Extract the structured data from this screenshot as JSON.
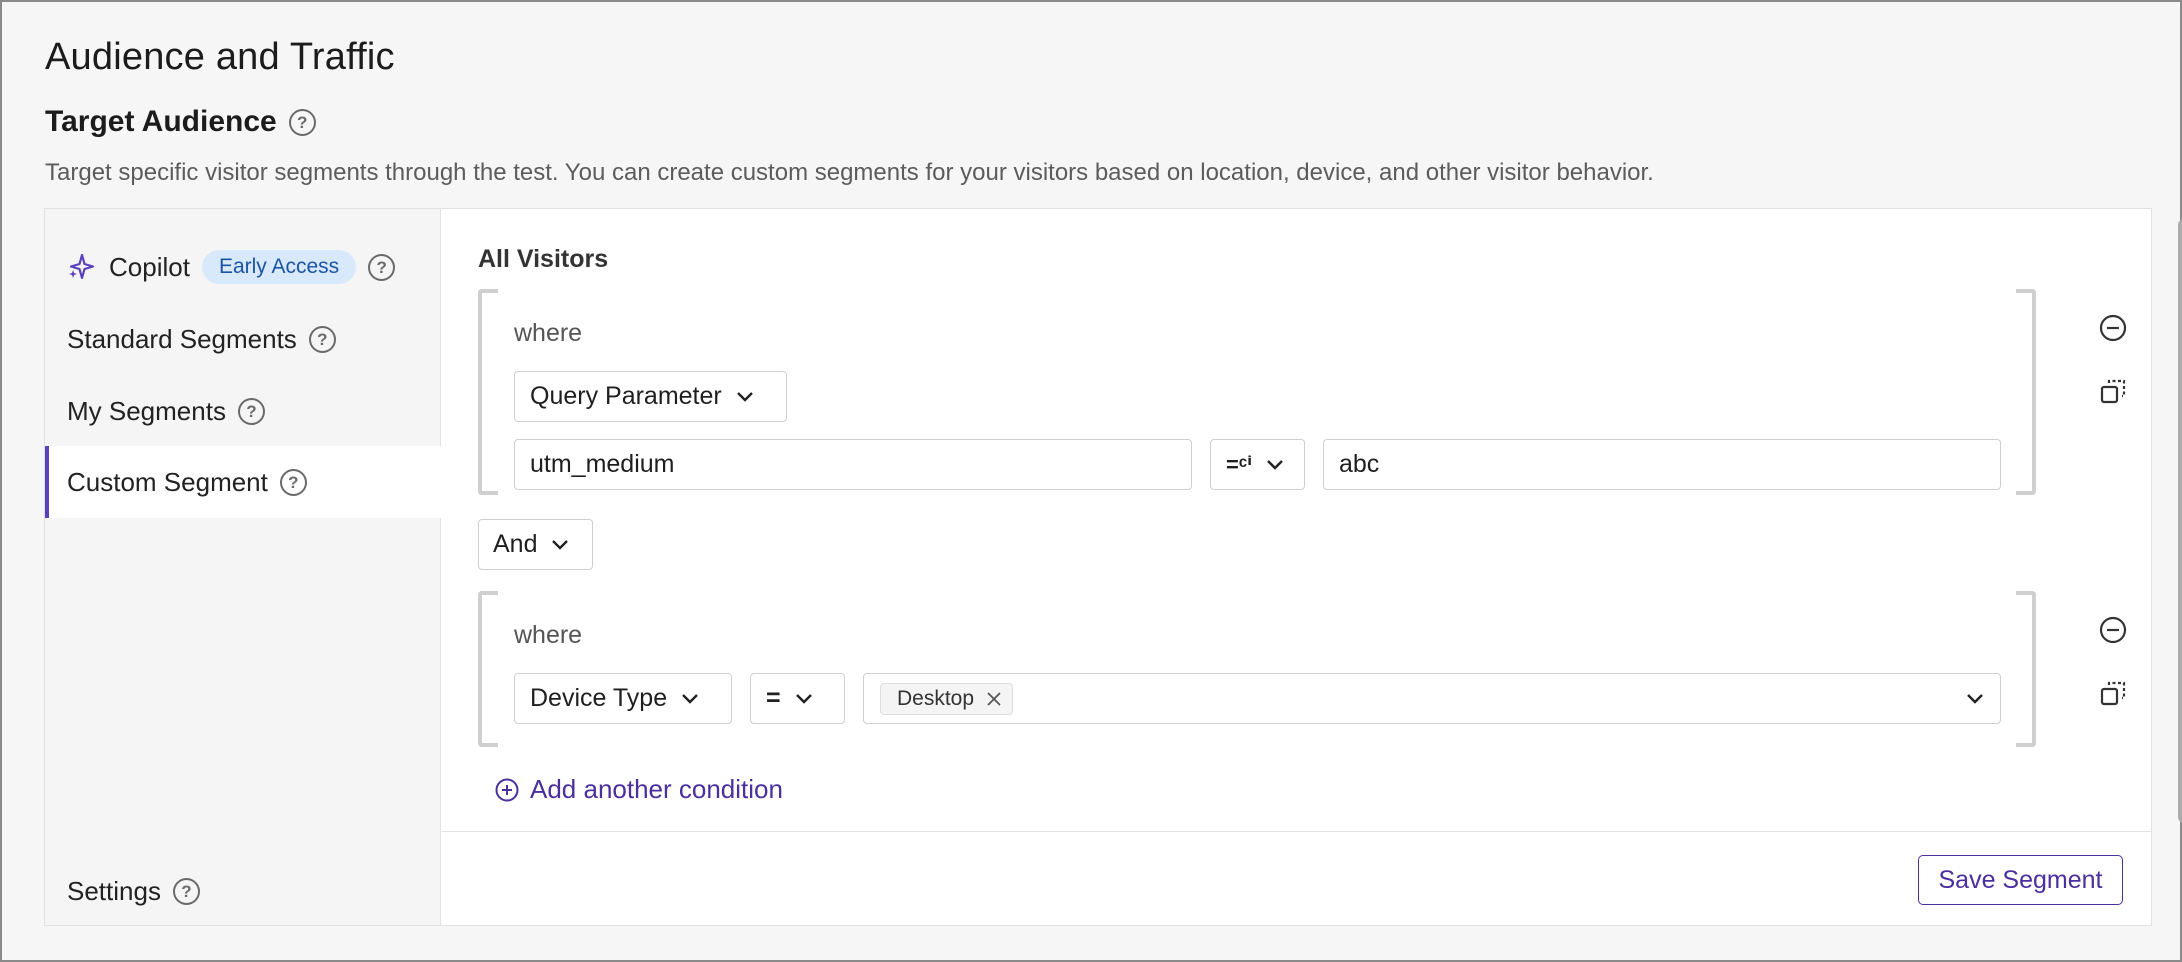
{
  "page": {
    "title": "Audience and Traffic",
    "section_title": "Target Audience",
    "section_desc": "Target specific visitor segments through the test. You can create custom segments for your visitors based on location, device, and other visitor behavior."
  },
  "sidebar": {
    "copilot_label": "Copilot",
    "copilot_badge": "Early Access",
    "items": [
      {
        "label": "Standard Segments"
      },
      {
        "label": "My Segments"
      },
      {
        "label": "Custom Segment"
      }
    ],
    "settings_label": "Settings",
    "active_item": "Custom Segment"
  },
  "segment": {
    "header": "All Visitors",
    "groups": [
      {
        "where": "where",
        "field": "Query Parameter",
        "param": "utm_medium",
        "operator": "=ᶜⁱ",
        "value": "abc"
      },
      {
        "where": "where",
        "field": "Device Type",
        "operator": "=",
        "tags": [
          "Desktop"
        ]
      }
    ],
    "connector": "And",
    "add_condition": "Add another condition",
    "save": "Save Segment"
  },
  "colors": {
    "accent": "#4b2f9f",
    "sidebar_active_border": "#5b3fbe",
    "badge_bg": "#d8e9fb",
    "badge_text": "#1b54a5"
  },
  "icons": {
    "copilot": "sparkle-icon",
    "help": "question-circle-icon",
    "remove": "minus-circle-icon",
    "duplicate": "duplicate-icon",
    "add": "plus-circle-icon",
    "dropdown": "chevron-down-icon",
    "tag_remove": "close-icon"
  }
}
